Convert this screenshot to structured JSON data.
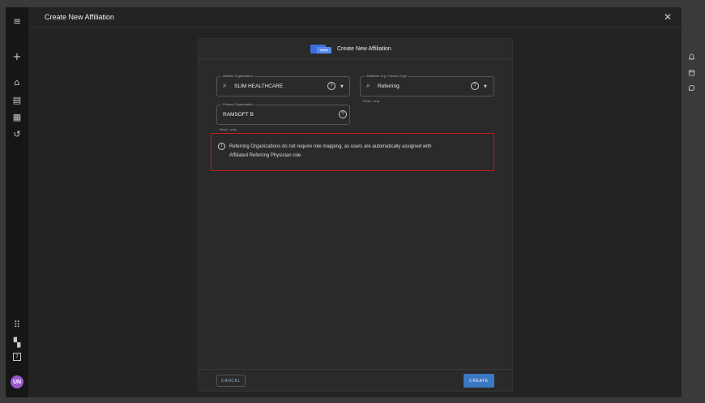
{
  "sidebar": {
    "menu_icon": "≡",
    "add_icon": "+",
    "home_icon": "⌂",
    "worklist_icon": "▤",
    "calendar_icon": "▦",
    "history_icon": "↺",
    "apps_icon": "⠿",
    "widgets_icon": "▚",
    "help_icon": "?",
    "avatar_initials": "UN",
    "avatar_color": "#9b59d0"
  },
  "header": {
    "title": "Create New Affiliation",
    "close_icon": "✕"
  },
  "right_rail": {
    "bell_icon": "🔔",
    "calendar_icon": "▤",
    "chat_icon": "○"
  },
  "dialog": {
    "title": "Create New Affiliation",
    "affiliate_org": {
      "label": "Affiliate Organization",
      "value": "SLIM HEALTHCARE"
    },
    "practice_type": {
      "label": "Affiliation Org. Practice Type",
      "value": "Referring",
      "helper": "Read - only"
    },
    "primary_org": {
      "label": "Primary Organization",
      "value": "RAMSOFT B",
      "helper": "Read - only"
    },
    "alert": {
      "line1": "Referring Organizations do not require role mapping, as users are automatically assigned with",
      "line2": "Affiliated Referring Physician role."
    },
    "cancel_label": "CANCEL",
    "create_label": "CREATE",
    "accent_color": "#3b78c2",
    "alert_border_color": "#c41c1c"
  }
}
